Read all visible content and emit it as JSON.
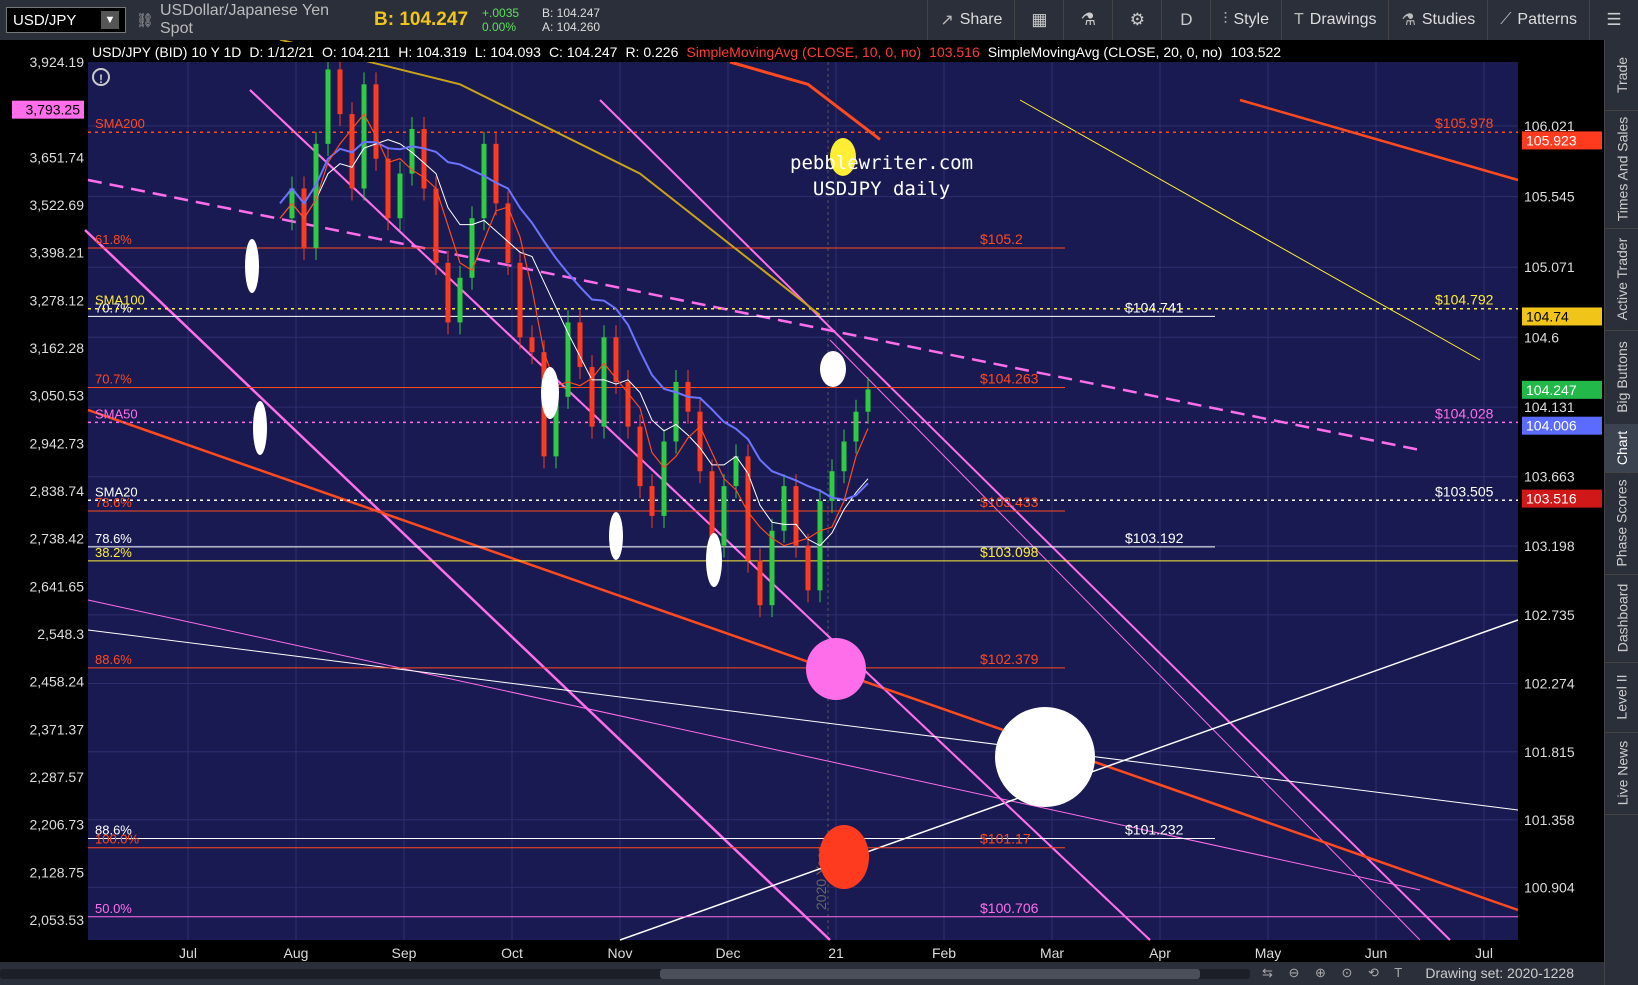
{
  "toolbar": {
    "symbol": "USD/JPY",
    "description": "USDollar/Japanese Yen Spot",
    "bid_label": "B: 104.247",
    "change": "+.0035",
    "change_pct": "0.00%",
    "bid_small": "B: 104.247",
    "ask_small": "A: 104.260",
    "share": "Share",
    "period": "D",
    "style": "Style",
    "drawings": "Drawings",
    "studies": "Studies",
    "patterns": "Patterns"
  },
  "status": {
    "title": "USD/JPY (BID) 10 Y 1D",
    "date": "D: 1/12/21",
    "open": "O: 104.211",
    "high": "H: 104.319",
    "low": "L: 104.093",
    "close": "C: 104.247",
    "range": "R: 0.226",
    "sma10_label": "SimpleMovingAvg (CLOSE, 10, 0, no)",
    "sma10_value": "103.516",
    "sma20_label": "SimpleMovingAvg (CLOSE, 20, 0, no)",
    "sma20_value": "103.522"
  },
  "watermark": {
    "line1": "pebblewriter.com",
    "line2": "USDJPY daily"
  },
  "colors": {
    "background": "#1a1a52",
    "grid": "#2e2e6e",
    "red": "#ff4a1f",
    "magenta": "#ff6eea",
    "white": "#ffffff",
    "yellow": "#ffee33",
    "olive": "#c9a21a",
    "blue_ma": "#6b74ff",
    "up_candle": "#2ecc40",
    "down_candle": "#ff3b1f"
  },
  "chart_data": {
    "type": "candlestick",
    "x_ticks": [
      "Jul",
      "Aug",
      "Sep",
      "Oct",
      "Nov",
      "Dec",
      "21",
      "Feb",
      "Mar",
      "Apr",
      "May",
      "Jun",
      "Jul"
    ],
    "year_marker": "2020 Year",
    "left_axis_ticks": [
      "3,924.19",
      "3,793.25",
      "3,651.74",
      "3,522.69",
      "3,398.21",
      "3,278.12",
      "3,162.28",
      "3,050.53",
      "2,942.73",
      "2,838.74",
      "2,738.42",
      "2,641.65",
      "2,548.3",
      "2,458.24",
      "2,371.37",
      "2,287.57",
      "2,206.73",
      "2,128.75",
      "2,053.53"
    ],
    "left_axis_highlight": "3,793.25",
    "right_axis_ticks": [
      "106.021",
      "105.545",
      "105.071",
      "104.6",
      "104.131",
      "103.663",
      "103.198",
      "102.735",
      "102.274",
      "101.815",
      "101.358",
      "100.904"
    ],
    "right_axis_range": [
      100.55,
      106.45
    ],
    "badges": [
      {
        "text": "105.923",
        "value": 105.923,
        "bg": "#ff3b1f",
        "fg": "#ffffff"
      },
      {
        "text": "104.74",
        "value": 104.74,
        "bg": "#f0c419",
        "fg": "#000000"
      },
      {
        "text": "104.247",
        "value": 104.247,
        "bg": "#22b84a",
        "fg": "#ffffff"
      },
      {
        "text": "104.006",
        "value": 104.006,
        "bg": "#5b6bff",
        "fg": "#ffffff"
      },
      {
        "text": "103.516",
        "value": 103.516,
        "bg": "#d01818",
        "fg": "#ffffff"
      }
    ],
    "fib_levels": [
      {
        "label": "61.8%",
        "value": 105.2,
        "price": "$105.2",
        "color": "#ff4a1f"
      },
      {
        "label": "70.7%",
        "value": 104.263,
        "price": "$104.263",
        "color": "#ff4a1f"
      },
      {
        "label": "78.6%",
        "value": 103.192,
        "price": "$103.192",
        "color": "#ffffff"
      },
      {
        "label": "38.2%",
        "value": 103.098,
        "price": "$103.098",
        "color": "#ffee33"
      },
      {
        "label": "88.6%",
        "value": 102.379,
        "price": "$102.379",
        "color": "#ff4a1f"
      },
      {
        "label": "88.6%",
        "value": 101.232,
        "price": "$101.232",
        "color": "#ffffff"
      },
      {
        "label": "100.0%",
        "value": 101.17,
        "price": "$101.17",
        "color": "#ff4a1f"
      },
      {
        "label": "50.0%",
        "value": 100.706,
        "price": "$100.706",
        "color": "#ff6eea"
      },
      {
        "label": "70.7%",
        "value": 104.741,
        "price": "$104.741",
        "color": "#ffffff"
      },
      {
        "label": "78.6%",
        "value": 103.433,
        "price": "$103.433",
        "color": "#ff4a1f"
      }
    ],
    "sma_labels": [
      {
        "label": "SMA200",
        "value": 105.978,
        "price": "$105.978",
        "color": "#ff4a1f"
      },
      {
        "label": "SMA100",
        "value": 104.792,
        "price": "$104.792",
        "color": "#ffee33"
      },
      {
        "label": "SMA50",
        "value": 104.028,
        "price": "$104.028",
        "color": "#ff6eea"
      },
      {
        "label": "SMA20",
        "value": 103.505,
        "price": "$103.505",
        "color": "#ffffff"
      }
    ],
    "price_path": [
      [
        0,
        105.4
      ],
      [
        2,
        105.6
      ],
      [
        4,
        105.2
      ],
      [
        6,
        105.9
      ],
      [
        8,
        106.4
      ],
      [
        10,
        106.1
      ],
      [
        12,
        105.6
      ],
      [
        14,
        106.3
      ],
      [
        16,
        105.8
      ],
      [
        18,
        105.4
      ],
      [
        20,
        105.7
      ],
      [
        22,
        106.0
      ],
      [
        24,
        105.6
      ],
      [
        26,
        105.1
      ],
      [
        28,
        104.7
      ],
      [
        30,
        105.0
      ],
      [
        32,
        105.4
      ],
      [
        34,
        105.9
      ],
      [
        36,
        105.5
      ],
      [
        38,
        105.1
      ],
      [
        40,
        104.6
      ],
      [
        42,
        104.5
      ],
      [
        44,
        103.8
      ],
      [
        46,
        104.2
      ],
      [
        48,
        104.7
      ],
      [
        50,
        104.4
      ],
      [
        52,
        104.0
      ],
      [
        54,
        104.6
      ],
      [
        56,
        104.3
      ],
      [
        58,
        104.0
      ],
      [
        60,
        103.6
      ],
      [
        62,
        103.4
      ],
      [
        64,
        103.9
      ],
      [
        66,
        104.3
      ],
      [
        68,
        104.1
      ],
      [
        70,
        103.7
      ],
      [
        72,
        103.2
      ],
      [
        74,
        103.6
      ],
      [
        76,
        103.8
      ],
      [
        78,
        103.1
      ],
      [
        80,
        102.8
      ],
      [
        82,
        103.3
      ],
      [
        84,
        103.6
      ],
      [
        86,
        103.2
      ],
      [
        88,
        102.9
      ],
      [
        90,
        103.5
      ],
      [
        92,
        103.7
      ],
      [
        94,
        103.9
      ],
      [
        96,
        104.1
      ],
      [
        98,
        104.25
      ]
    ]
  },
  "sidebar": {
    "tabs": [
      "Trade",
      "Times And Sales",
      "Active Trader",
      "Big Buttons",
      "Chart",
      "Phase Scores",
      "Dashboard",
      "Level II",
      "Live News"
    ],
    "active": "Chart"
  },
  "bottom": {
    "drawing_set": "Drawing set: 2020-1228"
  }
}
